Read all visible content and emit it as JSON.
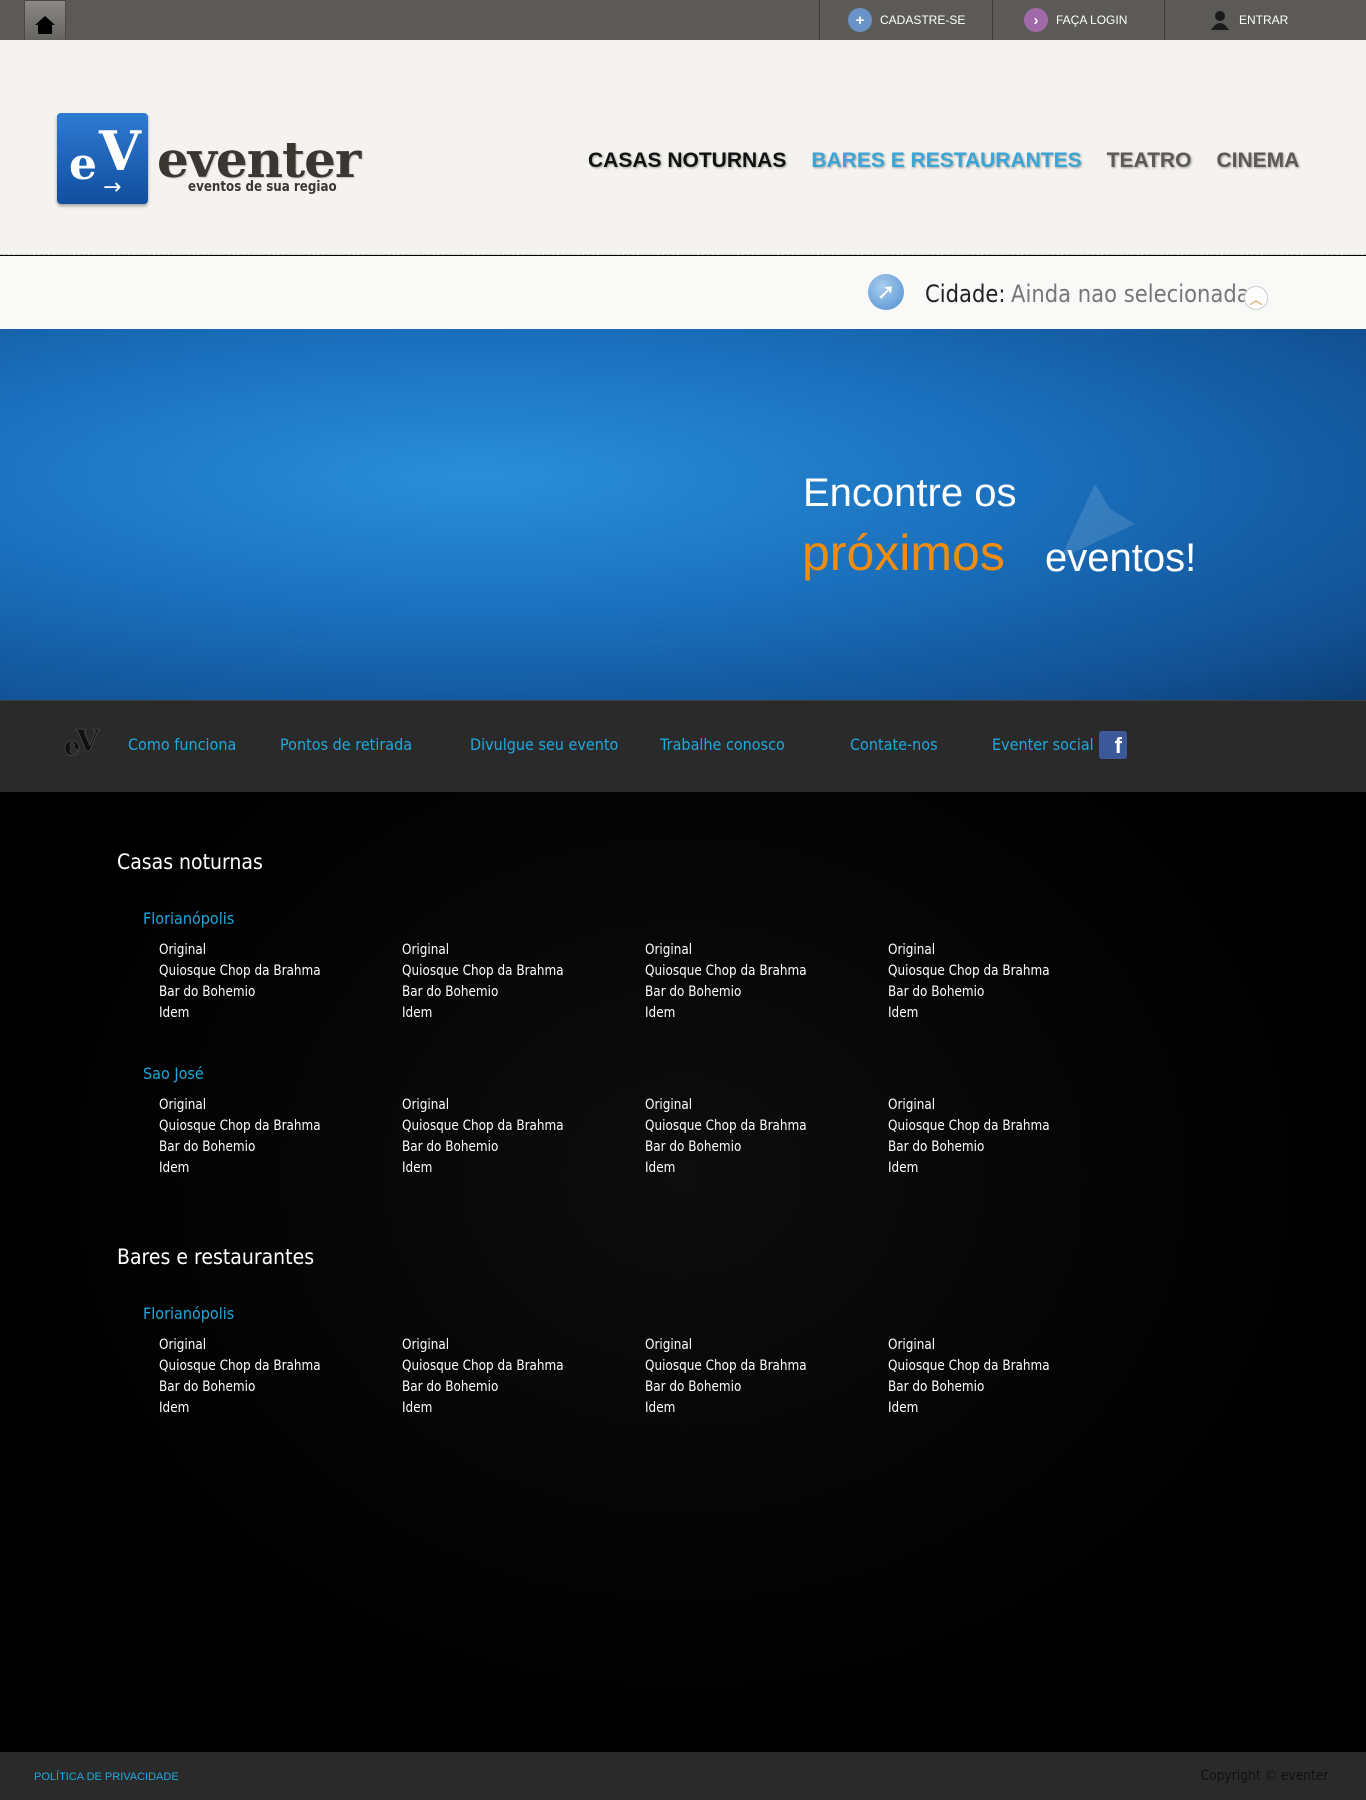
{
  "topbar": {
    "cadastre_label": "CADASTRE-SE",
    "login_label": "FAÇA LOGIN",
    "entrar_label": "ENTRAR"
  },
  "header": {
    "logo_word": "eventer",
    "logo_tagline": "eventos de sua regiao",
    "nav": [
      "CASAS NOTURNAS",
      "BARES E RESTAURANTES",
      "TEATRO",
      "CINEMA"
    ]
  },
  "city": {
    "label": "Cidade:",
    "value": "Ainda nao selecionada"
  },
  "banner": {
    "line1": "Encontre os",
    "highlight": "próximos",
    "line2": "eventos!"
  },
  "subnav": {
    "items": [
      "Como funciona",
      "Pontos de retirada",
      "Divulgue seu evento",
      "Trabalhe conosco",
      "Contate-nos",
      "Eventer social"
    ]
  },
  "sections": [
    {
      "title": "Casas noturnas",
      "cities": [
        {
          "name": "Florianópolis",
          "columns": [
            [
              "Original",
              "Quiosque Chop da Brahma",
              "Bar do Bohemio",
              "Idem"
            ],
            [
              "Original",
              "Quiosque Chop da Brahma",
              "Bar do Bohemio",
              "Idem"
            ],
            [
              "Original",
              "Quiosque Chop da Brahma",
              "Bar do Bohemio",
              "Idem"
            ],
            [
              "Original",
              "Quiosque Chop da Brahma",
              "Bar do Bohemio",
              "Idem"
            ]
          ]
        },
        {
          "name": "Sao José",
          "columns": [
            [
              "Original",
              "Quiosque Chop da Brahma",
              "Bar do Bohemio",
              "Idem"
            ],
            [
              "Original",
              "Quiosque Chop da Brahma",
              "Bar do Bohemio",
              "Idem"
            ],
            [
              "Original",
              "Quiosque Chop da Brahma",
              "Bar do Bohemio",
              "Idem"
            ],
            [
              "Original",
              "Quiosque Chop da Brahma",
              "Bar do Bohemio",
              "Idem"
            ]
          ]
        }
      ]
    },
    {
      "title": "Bares e restaurantes",
      "cities": [
        {
          "name": "Florianópolis",
          "columns": [
            [
              "Original",
              "Quiosque Chop da Brahma",
              "Bar do Bohemio",
              "Idem"
            ],
            [
              "Original",
              "Quiosque Chop da Brahma",
              "Bar do Bohemio",
              "Idem"
            ],
            [
              "Original",
              "Quiosque Chop da Brahma",
              "Bar do Bohemio",
              "Idem"
            ],
            [
              "Original",
              "Quiosque Chop da Brahma",
              "Bar do Bohemio",
              "Idem"
            ]
          ]
        }
      ]
    }
  ],
  "footer": {
    "privacy": "POLÍTICA DE PRIVACIDADE",
    "copyright": "Copyright © eventer"
  },
  "colors": {
    "accent": "#1fa8de",
    "highlight": "#f28c0f",
    "nav_active": "#3aa6d8"
  }
}
